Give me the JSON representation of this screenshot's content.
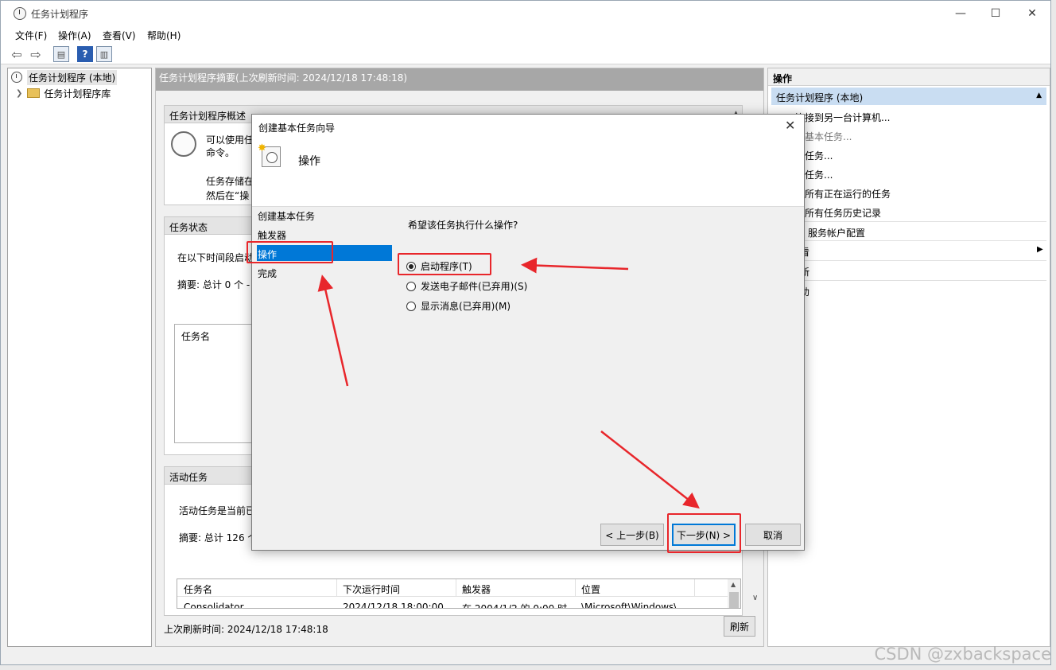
{
  "window": {
    "title": "任务计划程序",
    "min": "—",
    "max": "☐",
    "close": "✕"
  },
  "menu": [
    "文件(F)",
    "操作(A)",
    "查看(V)",
    "帮助(H)"
  ],
  "tree": {
    "root": "任务计划程序 (本地)",
    "library": "任务计划程序库"
  },
  "middle": {
    "header": "任务计划程序摘要(上次刷新时间: 2024/12/18 17:48:18)",
    "overview": {
      "title": "任务计划程序概述",
      "line1": "可以使用任",
      "line2": "命令。",
      "line3": "任务存储在",
      "line4": "然后在“操"
    },
    "status": {
      "title": "任务状态",
      "line1": "在以下时间段启动",
      "line2": "摘要: 总计 0 个 -",
      "col": "任务名"
    },
    "active": {
      "title": "活动任务",
      "line1": "活动任务是当前已",
      "line2": "摘要: 总计 126 个",
      "columns": [
        "任务名",
        "下次运行时间",
        "触发器",
        "位置"
      ],
      "row": [
        "Consolidator",
        "2024/12/18 18:00:00",
        "在 2004/1/2 的 0:00 时",
        "\\Microsoft\\Windows\\"
      ]
    },
    "footer": "上次刷新时间: 2024/12/18 17:48:18",
    "refresh": "刷新"
  },
  "right": {
    "header": "操作",
    "sub": "任务计划程序 (本地)",
    "items": [
      "连接到另一台计算机...",
      "创建基本任务...",
      "创建任务...",
      "导入任务...",
      "显示所有正在运行的任务",
      "启用所有任务历史记录",
      "AT 服务帐户配置",
      "查看",
      "刷新",
      "帮助"
    ],
    "visible": [
      "连接到另一台计算机...",
      "建基本任务...",
      "建任务...",
      "入任务...",
      "示所有正在运行的任务",
      "用所有任务历史记录",
      "服务帐户配置",
      "看",
      "新",
      "助"
    ]
  },
  "dialog": {
    "title": "创建基本任务向导",
    "heading": "操作",
    "steps": [
      "创建基本任务",
      "触发器",
      "操作",
      "完成"
    ],
    "question": "希望该任务执行什么操作?",
    "options": [
      "启动程序(T)",
      "发送电子邮件(已弃用)(S)",
      "显示消息(已弃用)(M)"
    ],
    "buttons": {
      "back": "< 上一步(B)",
      "next": "下一步(N) >",
      "cancel": "取消"
    }
  },
  "watermark": "CSDN @zxbackspace",
  "annotation_color": "#e8262b"
}
